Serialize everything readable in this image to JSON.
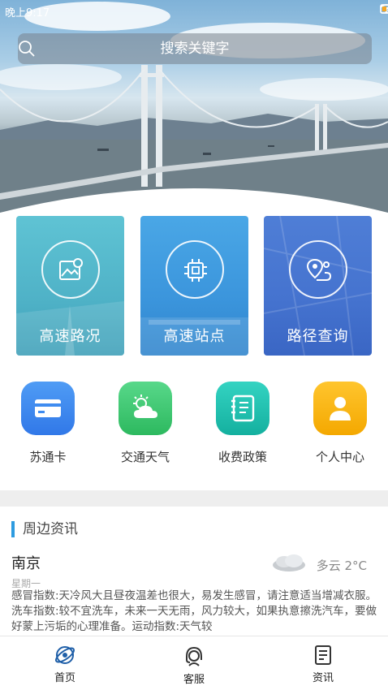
{
  "status_bar": {
    "time": "晚上9:17"
  },
  "search": {
    "placeholder": "搜索关键字"
  },
  "tiles": [
    {
      "label": "高速路况",
      "icon": "map-photo-icon"
    },
    {
      "label": "高速站点",
      "icon": "chip-icon"
    },
    {
      "label": "路径查询",
      "icon": "route-pin-icon"
    }
  ],
  "menu": [
    {
      "label": "苏通卡",
      "icon": "card-icon",
      "color": "#3f8cf0"
    },
    {
      "label": "交通天气",
      "icon": "weather-icon",
      "color": "#3cc56b"
    },
    {
      "label": "收费政策",
      "icon": "notebook-icon",
      "color": "#21c2b0"
    },
    {
      "label": "个人中心",
      "icon": "user-icon",
      "color": "#f7b500"
    }
  ],
  "news": {
    "section_title": "周边资讯",
    "city": "南京",
    "weekday": "星期一",
    "weather": "多云 2°C",
    "description": "感冒指数:天冷风大且昼夜温差也很大，易发生感冒，请注意适当增减衣服。洗车指数:较不宜洗车，未来一天无雨，风力较大，如果执意擦洗汽车，要做好蒙上污垢的心理准备。运动指数:天气较"
  },
  "tabbar": [
    {
      "label": "首页",
      "icon": "home-icon"
    },
    {
      "label": "客服",
      "icon": "customer-service-icon"
    },
    {
      "label": "资讯",
      "icon": "news-icon"
    }
  ],
  "colors": {
    "accent": "#2d9be0"
  }
}
